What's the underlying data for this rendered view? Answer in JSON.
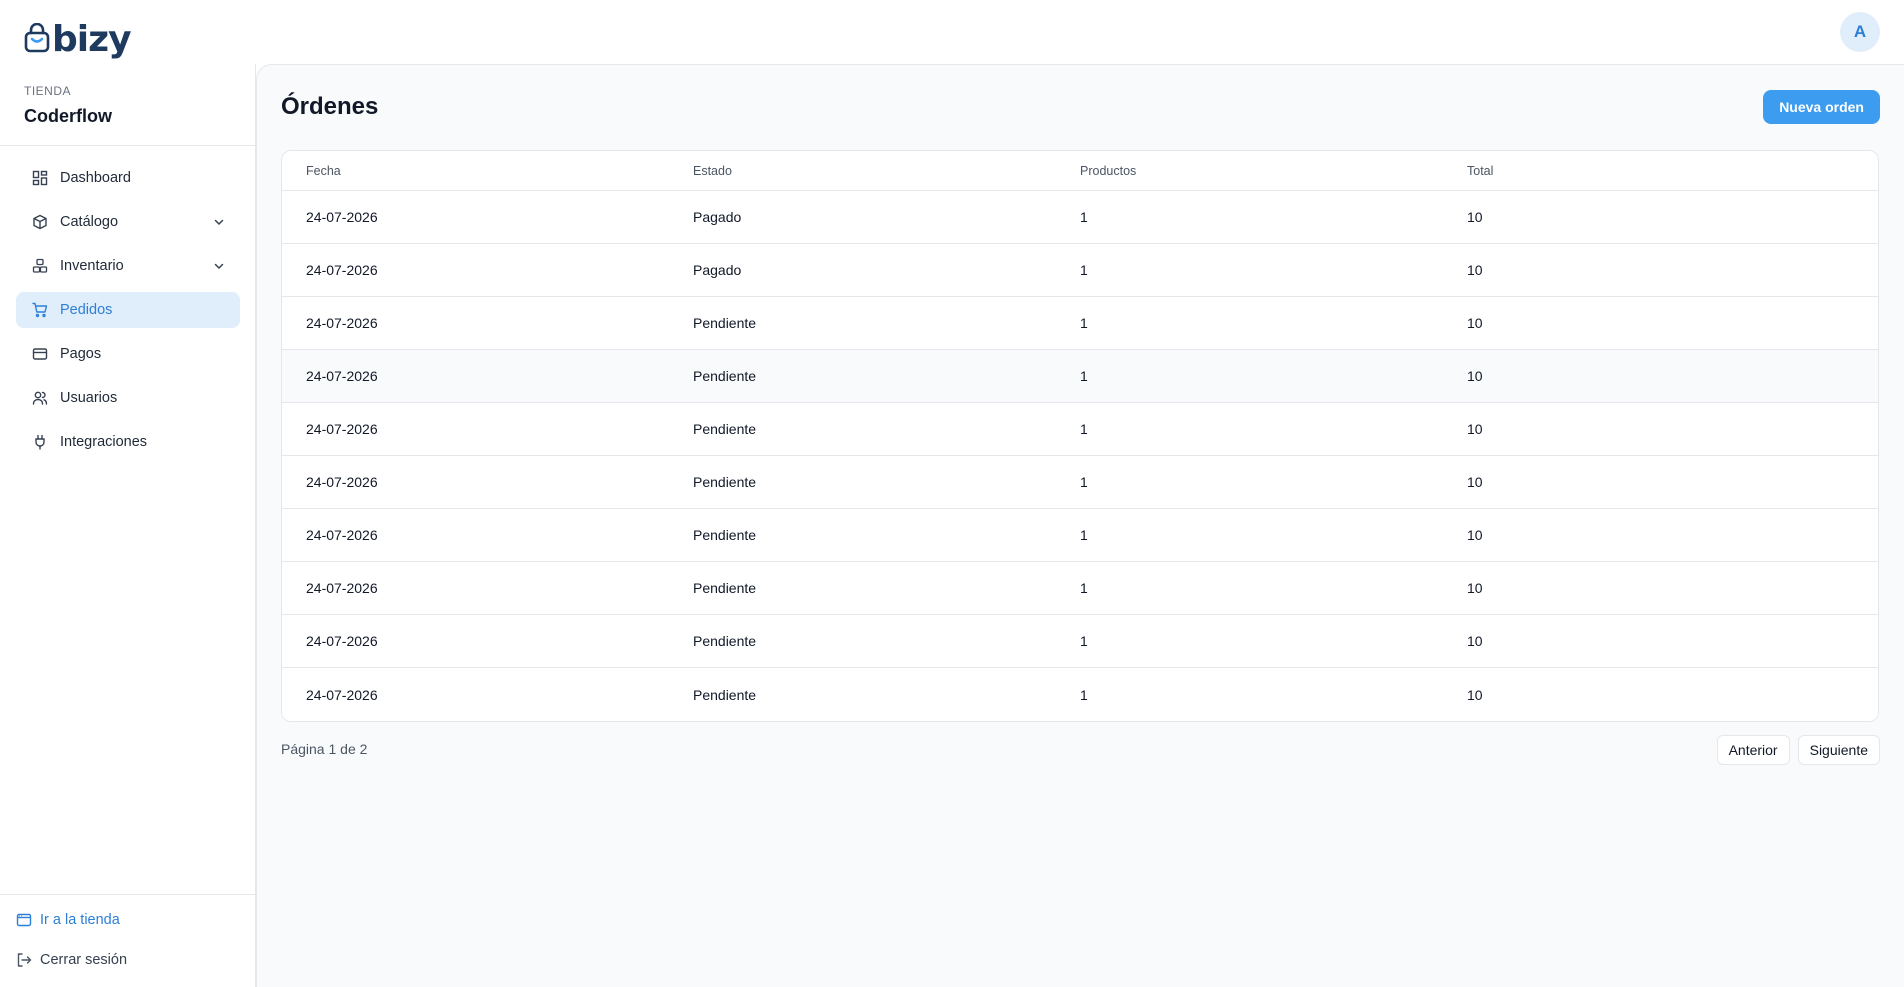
{
  "brand": {
    "logo_text": "bizy",
    "logo_color": "#1e3a5f"
  },
  "user": {
    "avatar_initial": "A"
  },
  "sidebar": {
    "store_label": "TIENDA",
    "store_name": "Coderflow",
    "items": [
      {
        "label": "Dashboard",
        "icon": "dashboard-icon",
        "active": false,
        "has_chevron": false
      },
      {
        "label": "Catálogo",
        "icon": "box-icon",
        "active": false,
        "has_chevron": true
      },
      {
        "label": "Inventario",
        "icon": "boxes-icon",
        "active": false,
        "has_chevron": true
      },
      {
        "label": "Pedidos",
        "icon": "cart-icon",
        "active": true,
        "has_chevron": false
      },
      {
        "label": "Pagos",
        "icon": "credit-card-icon",
        "active": false,
        "has_chevron": false
      },
      {
        "label": "Usuarios",
        "icon": "users-icon",
        "active": false,
        "has_chevron": false
      },
      {
        "label": "Integraciones",
        "icon": "plug-icon",
        "active": false,
        "has_chevron": false
      }
    ],
    "store_link_label": "Ir a la tienda",
    "logout_label": "Cerrar sesión"
  },
  "main": {
    "title": "Órdenes",
    "new_button_label": "Nueva orden",
    "table": {
      "headers": [
        "Fecha",
        "Estado",
        "Productos",
        "Total"
      ],
      "rows": [
        [
          "24-07-2026",
          "Pagado",
          "1",
          "10"
        ],
        [
          "24-07-2026",
          "Pagado",
          "1",
          "10"
        ],
        [
          "24-07-2026",
          "Pendiente",
          "1",
          "10"
        ],
        [
          "24-07-2026",
          "Pendiente",
          "1",
          "10"
        ],
        [
          "24-07-2026",
          "Pendiente",
          "1",
          "10"
        ],
        [
          "24-07-2026",
          "Pendiente",
          "1",
          "10"
        ],
        [
          "24-07-2026",
          "Pendiente",
          "1",
          "10"
        ],
        [
          "24-07-2026",
          "Pendiente",
          "1",
          "10"
        ],
        [
          "24-07-2026",
          "Pendiente",
          "1",
          "10"
        ],
        [
          "24-07-2026",
          "Pendiente",
          "1",
          "10"
        ]
      ]
    },
    "pagination": {
      "text": "Página 1 de 2",
      "prev_label": "Anterior",
      "next_label": "Siguiente"
    }
  },
  "colors": {
    "accent": "#3b9cf0",
    "active_bg": "#e0eefb",
    "active_text": "#2d7fd6"
  }
}
